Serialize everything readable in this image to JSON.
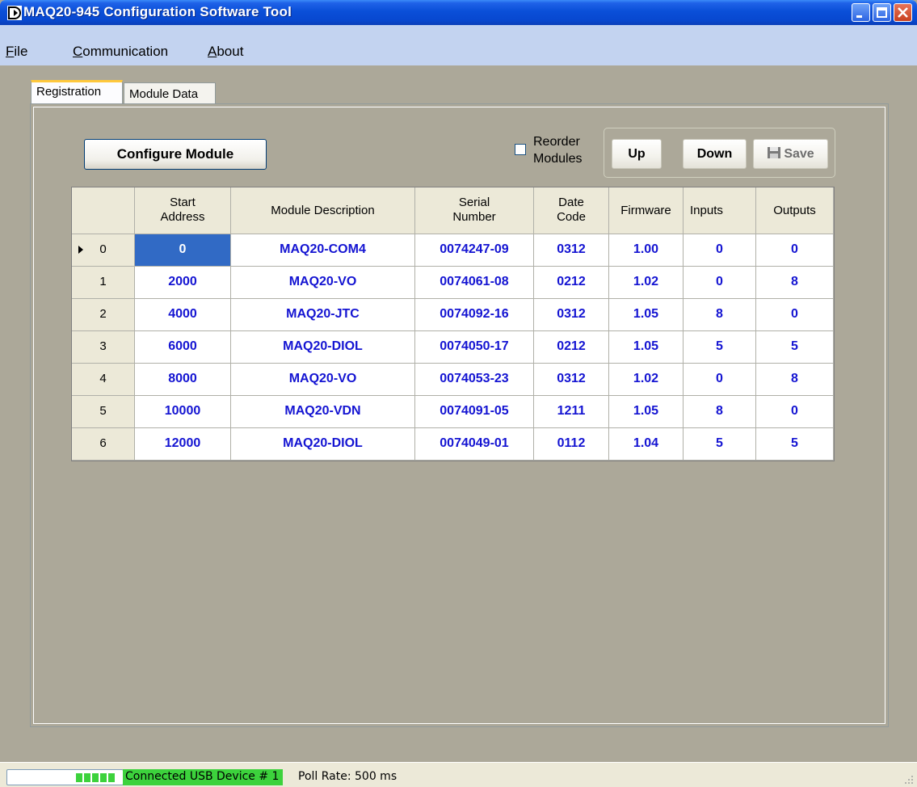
{
  "window": {
    "title": "MAQ20-945 Configuration Software Tool"
  },
  "menu": [
    {
      "label": "File",
      "accel": "F",
      "rest": "ile"
    },
    {
      "label": "Communication",
      "accel": "C",
      "rest": "ommunication"
    },
    {
      "label": "About",
      "accel": "A",
      "rest": "bout"
    }
  ],
  "tabs": [
    {
      "label": "Registration",
      "active": true
    },
    {
      "label": "Module Data",
      "active": false
    }
  ],
  "toolbar": {
    "configure_label": "Configure Module",
    "reorder_line1": "Reorder",
    "reorder_line2": "Modules",
    "reorder_checked": false,
    "up_label": "Up",
    "down_label": "Down",
    "save_label": "Save"
  },
  "grid": {
    "headers": [
      {
        "line1": "Start",
        "line2": "Address"
      },
      {
        "line1": "Module Description",
        "line2": ""
      },
      {
        "line1": "Serial",
        "line2": "Number"
      },
      {
        "line1": "Date",
        "line2": "Code"
      },
      {
        "line1": "Firmware",
        "line2": ""
      },
      {
        "line1": "Inputs",
        "line2": ""
      },
      {
        "line1": "Outputs",
        "line2": ""
      }
    ],
    "rows": [
      {
        "index": "0",
        "current": true,
        "start": "0",
        "desc": "MAQ20-COM4",
        "serial": "0074247-09",
        "date": "0312",
        "fw": "1.00",
        "in": "0",
        "out": "0"
      },
      {
        "index": "1",
        "current": false,
        "start": "2000",
        "desc": "MAQ20-VO",
        "serial": "0074061-08",
        "date": "0212",
        "fw": "1.02",
        "in": "0",
        "out": "8"
      },
      {
        "index": "2",
        "current": false,
        "start": "4000",
        "desc": "MAQ20-JTC",
        "serial": "0074092-16",
        "date": "0312",
        "fw": "1.05",
        "in": "8",
        "out": "0"
      },
      {
        "index": "3",
        "current": false,
        "start": "6000",
        "desc": "MAQ20-DIOL",
        "serial": "0074050-17",
        "date": "0212",
        "fw": "1.05",
        "in": "5",
        "out": "5"
      },
      {
        "index": "4",
        "current": false,
        "start": "8000",
        "desc": "MAQ20-VO",
        "serial": "0074053-23",
        "date": "0312",
        "fw": "1.02",
        "in": "0",
        "out": "8"
      },
      {
        "index": "5",
        "current": false,
        "start": "10000",
        "desc": "MAQ20-VDN",
        "serial": "0074091-05",
        "date": "1211",
        "fw": "1.05",
        "in": "8",
        "out": "0"
      },
      {
        "index": "6",
        "current": false,
        "start": "12000",
        "desc": "MAQ20-DIOL",
        "serial": "0074049-01",
        "date": "0112",
        "fw": "1.04",
        "in": "5",
        "out": "5"
      }
    ]
  },
  "status": {
    "connection": "Connected USB Device # 1",
    "poll": "Poll Rate: 500 ms",
    "connection_color": "#3CD23C"
  },
  "colors": {
    "accent_blue": "#1414D2",
    "selection": "#316AC5",
    "title_bar": "#0A4FD8"
  }
}
